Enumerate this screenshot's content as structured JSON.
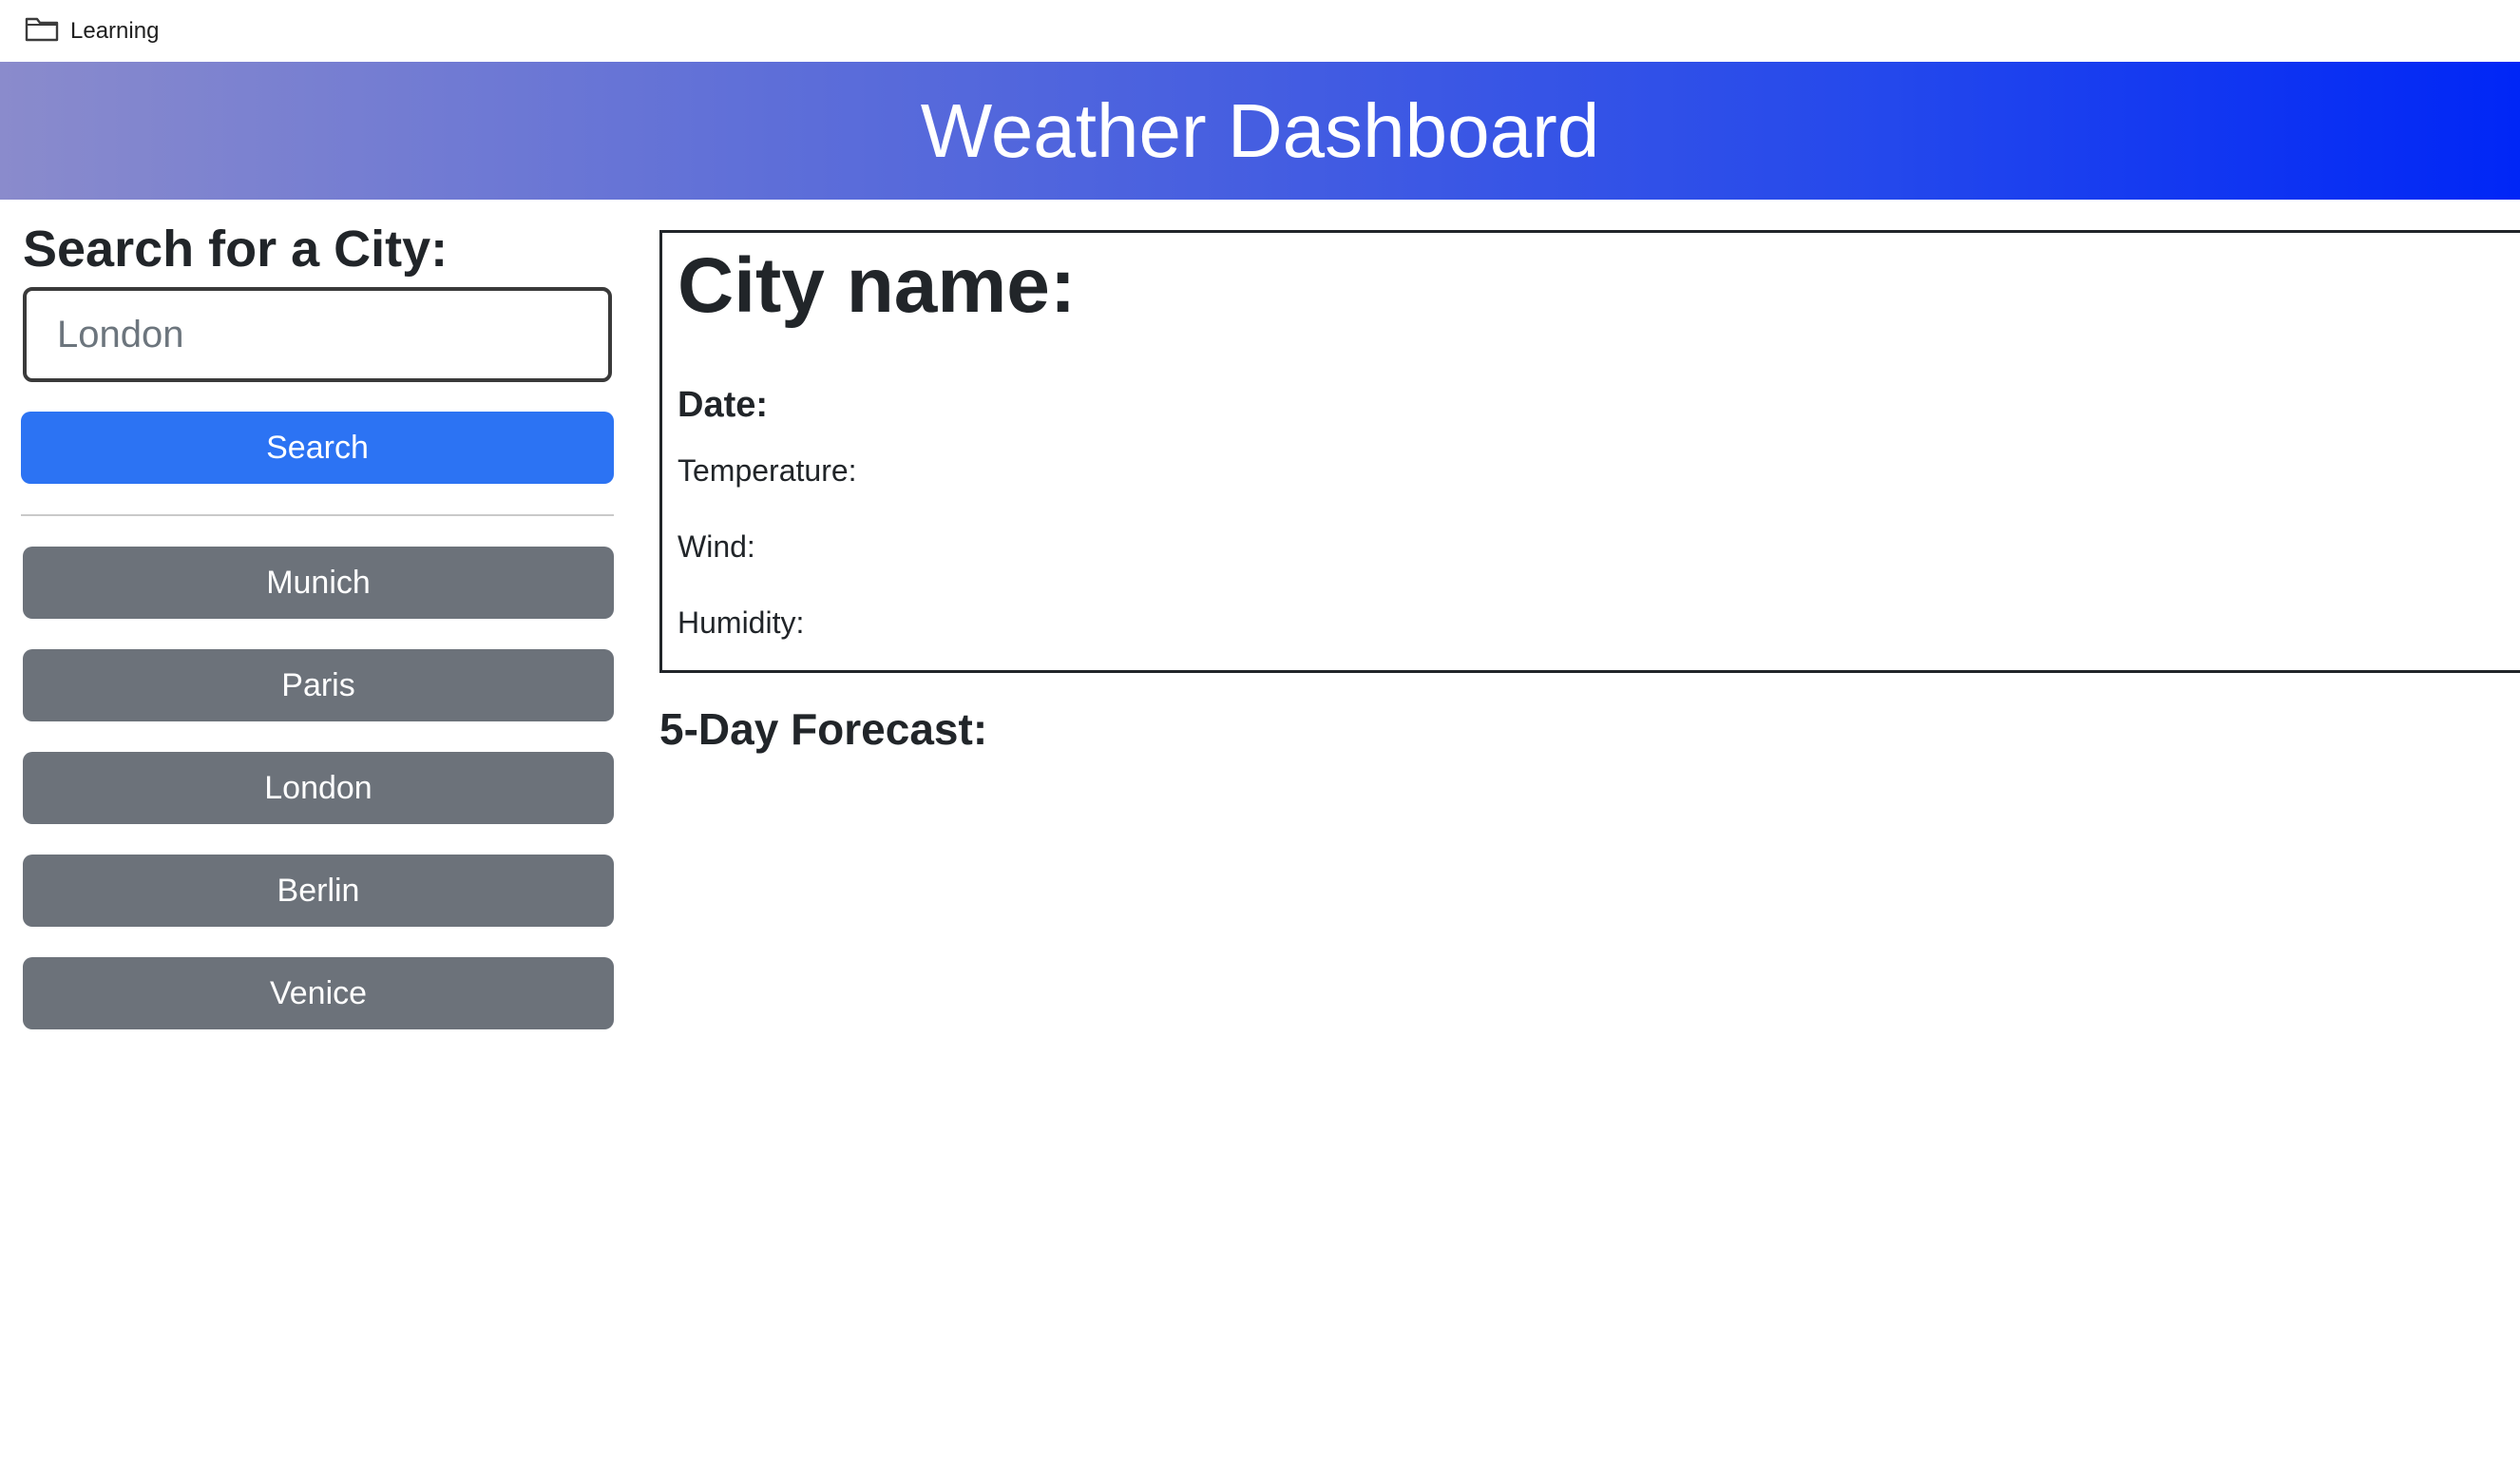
{
  "bookmarks_bar": {
    "items": [
      {
        "label": "Learning",
        "icon": "folder-icon"
      }
    ]
  },
  "header": {
    "title": "Weather Dashboard",
    "gradient_start": "#8a8bcc",
    "gradient_end": "#0026f6"
  },
  "search": {
    "heading": "Search for a City:",
    "input_value": "London",
    "button_label": "Search",
    "button_color": "#2c73f3"
  },
  "history": {
    "button_color": "#6c727a",
    "cities": [
      "Munich",
      "Paris",
      "London",
      "Berlin",
      "Venice"
    ]
  },
  "current": {
    "city_label": "City name:",
    "date_label": "Date:",
    "temperature_label": "Temperature:",
    "wind_label": "Wind:",
    "humidity_label": "Humidity:"
  },
  "forecast": {
    "heading": "5-Day Forecast:"
  }
}
